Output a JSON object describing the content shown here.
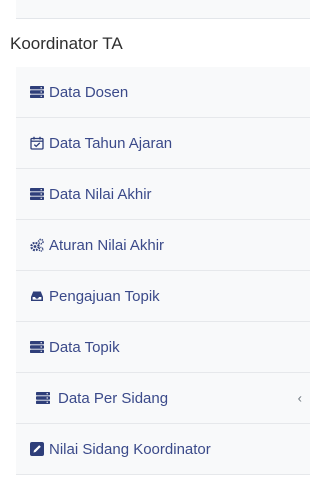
{
  "section_title": "Koordinator TA",
  "menu": {
    "items": [
      {
        "label": "Data Dosen",
        "icon": "database-icon"
      },
      {
        "label": "Data Tahun Ajaran",
        "icon": "calendar-check-icon"
      },
      {
        "label": "Data Nilai Akhir",
        "icon": "database-icon"
      },
      {
        "label": "Aturan Nilai Akhir",
        "icon": "cogs-icon"
      },
      {
        "label": "Pengajuan Topik",
        "icon": "inbox-icon"
      },
      {
        "label": "Data Topik",
        "icon": "database-icon"
      },
      {
        "label": "Data Per Sidang",
        "icon": "database-icon",
        "has_submenu": true,
        "chevron": "‹"
      },
      {
        "label": "Nilai Sidang Koordinator",
        "icon": "edit-icon"
      }
    ]
  },
  "colors": {
    "menu_text": "#3b4a8a",
    "icon": "#2f3f7a",
    "menu_bg": "#f8f9fa"
  }
}
